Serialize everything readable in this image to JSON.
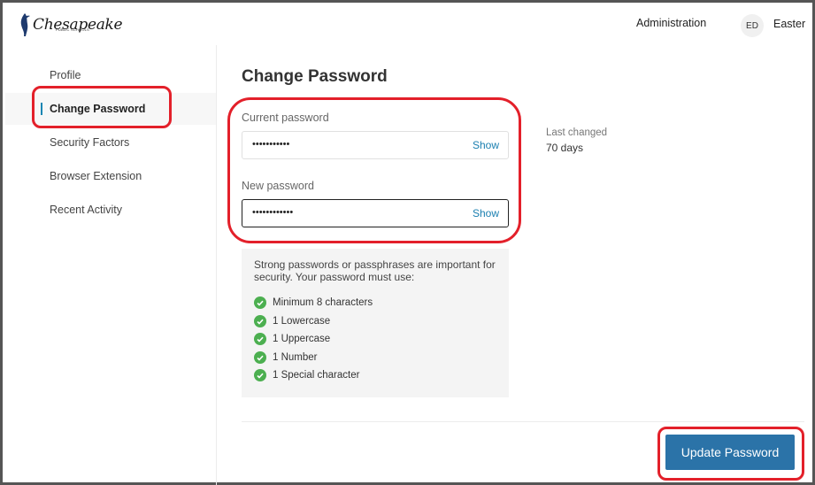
{
  "header": {
    "logo_text": "Chesapeake",
    "logo_subtext": "PUBLIC SCHOOLS",
    "admin_link": "Administration",
    "avatar_initials": "ED",
    "user_name": "Easter"
  },
  "sidebar": {
    "items": [
      {
        "label": "Profile"
      },
      {
        "label": "Change Password"
      },
      {
        "label": "Security Factors"
      },
      {
        "label": "Browser Extension"
      },
      {
        "label": "Recent Activity"
      }
    ],
    "active_index": 1
  },
  "main": {
    "title": "Change Password",
    "current_password": {
      "label": "Current password",
      "value": "•••••••••••",
      "toggle_label": "Show"
    },
    "new_password": {
      "label": "New password",
      "value": "••••••••••••",
      "toggle_label": "Show"
    },
    "last_changed": {
      "label": "Last changed",
      "value": "70 days"
    },
    "requirements": {
      "intro": "Strong passwords or passphrases are important for security. Your password must use:",
      "items": [
        {
          "label": "Minimum 8 characters",
          "met": true
        },
        {
          "label": "1 Lowercase",
          "met": true
        },
        {
          "label": "1 Uppercase",
          "met": true
        },
        {
          "label": "1 Number",
          "met": true
        },
        {
          "label": "1 Special character",
          "met": true
        }
      ]
    },
    "submit_label": "Update Password"
  },
  "colors": {
    "accent": "#2b73a8",
    "link": "#1a7fb0",
    "success": "#4caf50",
    "annotation": "#e3202a"
  }
}
